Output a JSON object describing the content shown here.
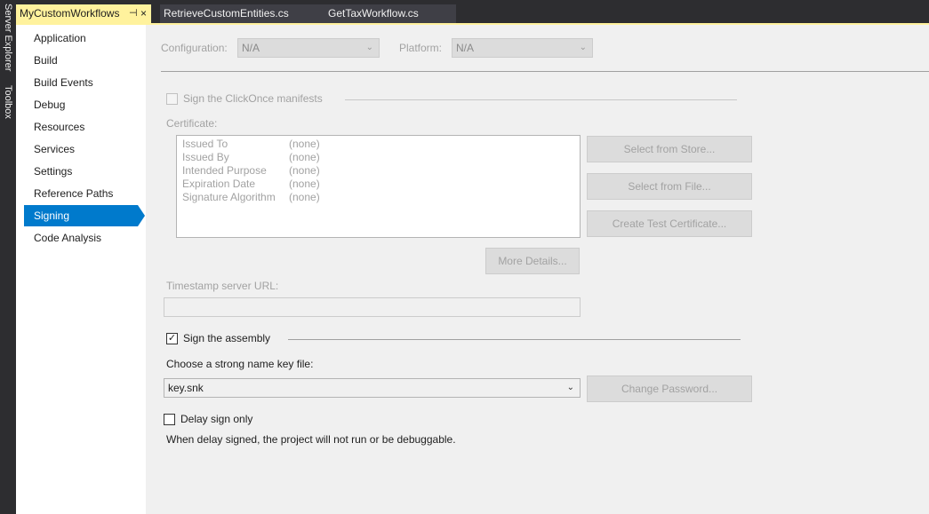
{
  "side_panels": [
    "Server Explorer",
    "Toolbox"
  ],
  "tabs": [
    {
      "label": "MyCustomWorkflows",
      "active": true
    },
    {
      "label": "RetrieveCustomEntities.cs",
      "active": false
    },
    {
      "label": "GetTaxWorkflow.cs",
      "active": false
    }
  ],
  "nav": {
    "items": [
      "Application",
      "Build",
      "Build Events",
      "Debug",
      "Resources",
      "Services",
      "Settings",
      "Reference Paths",
      "Signing",
      "Code Analysis"
    ],
    "selected": "Signing"
  },
  "config": {
    "configuration_label": "Configuration:",
    "configuration_value": "N/A",
    "platform_label": "Platform:",
    "platform_value": "N/A"
  },
  "signing": {
    "clickonce_label": "Sign the ClickOnce manifests",
    "clickonce_checked": false,
    "certificate_label": "Certificate:",
    "certificate_rows": [
      {
        "key": "Issued To",
        "value": "(none)"
      },
      {
        "key": "Issued By",
        "value": "(none)"
      },
      {
        "key": "Intended Purpose",
        "value": "(none)"
      },
      {
        "key": "Expiration Date",
        "value": "(none)"
      },
      {
        "key": "Signature Algorithm",
        "value": "(none)"
      }
    ],
    "select_store_button": "Select from Store...",
    "select_file_button": "Select from File...",
    "create_test_cert_button": "Create Test Certificate...",
    "more_details_button": "More Details...",
    "timestamp_label": "Timestamp server URL:",
    "timestamp_value": "",
    "sign_assembly_label": "Sign the assembly",
    "sign_assembly_checked": true,
    "key_file_label": "Choose a strong name key file:",
    "key_file_value": "key.snk",
    "change_password_button": "Change Password...",
    "delay_sign_label": "Delay sign only",
    "delay_sign_checked": false,
    "delay_sign_note": "When delay signed, the project will not run or be debuggable."
  },
  "colors": {
    "accent": "#007acc",
    "active_tab": "#fff29d",
    "chrome_dark": "#2d2d30"
  }
}
